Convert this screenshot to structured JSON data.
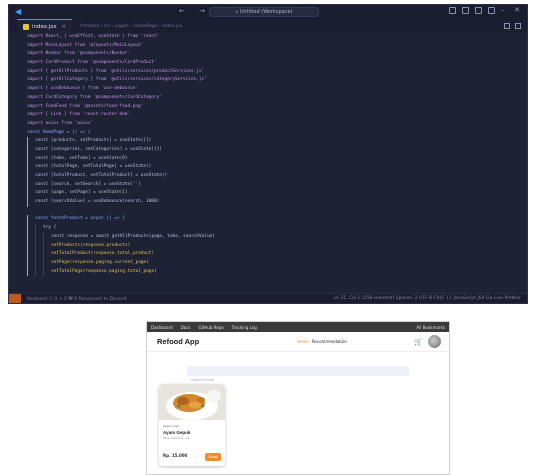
{
  "vscode": {
    "search_text": "Untitled (Workspace)",
    "tab": {
      "label": "index.jsx",
      "breadcrumb": "frontend › src › pages › HomePage › index.jsx"
    },
    "status_left": "Restored   ⓧ 0 ⚠ 0   ₩ 0   Reconnect to Discord",
    "status_right": "Ln 31, Col 1 (258 selected)   Spaces: 2   UTF-8   CRLF   {} JavaScript JSX   Go Live   Prettier",
    "code_lines": [
      "import React, { useEffect, useState } from 'react'",
      "import MainLayout from '@layouts/MainLayout'",
      "import Navbar from '@components/Navbar'",
      "import CardProduct from '@components/CardProduct'",
      "import { getAllProducts } from '@utils/services/productServices.js'",
      "import { getAllCategory } from '@utils/services/categoryServices.js'",
      "import { useDebounce } from 'use-debounce'",
      "import CardCategory from '@components/CardCategory'",
      "import FoodFood from '@assets/food-food.png'",
      "import { Link } from 'react-router-dom'",
      "import axios from 'axios'",
      "const HomePage = () => {",
      "  const [products, setProducts] = useState([])",
      "  const [categories, setCategories] = useState([])",
      "  const [take, setTake] = useState(8)",
      "  const [totalPage, setTotalPage] = useState()",
      "  const [totalProduct, setTotalProduct] = useState()",
      "  const [search, setSearch] = useState('')",
      "  const [page, setPage] = useState(1)",
      "  const [searchValue] = useDebounce(search, 1000)",
      "",
      "  const fetchProduct = async () => {",
      "    try {",
      "      const response = await getAllProducts(page, take, searchValue)",
      "      setProducts(response.products)",
      "      setTotalProduct(response.total_product)",
      "      setPage(response.paging.current_page)",
      "      setTotalPage(response.paging.total_page)"
    ]
  },
  "browser": {
    "bookmarks": [
      "Dashboard",
      "Docs",
      "GitHub Repo",
      "Tracking Log"
    ],
    "bookmarks_right": "All Bookmarks",
    "app_title": "Refood App",
    "nav": {
      "home": "Home",
      "recommendation": "Recommendation"
    },
    "search_placeholder": "Search Food",
    "card": {
      "category": "Ayam Lagi",
      "name": "Ayam Gepuk",
      "desc": "Stok makanan 22",
      "price": "Rp. 15,000",
      "button": "Detail"
    }
  }
}
